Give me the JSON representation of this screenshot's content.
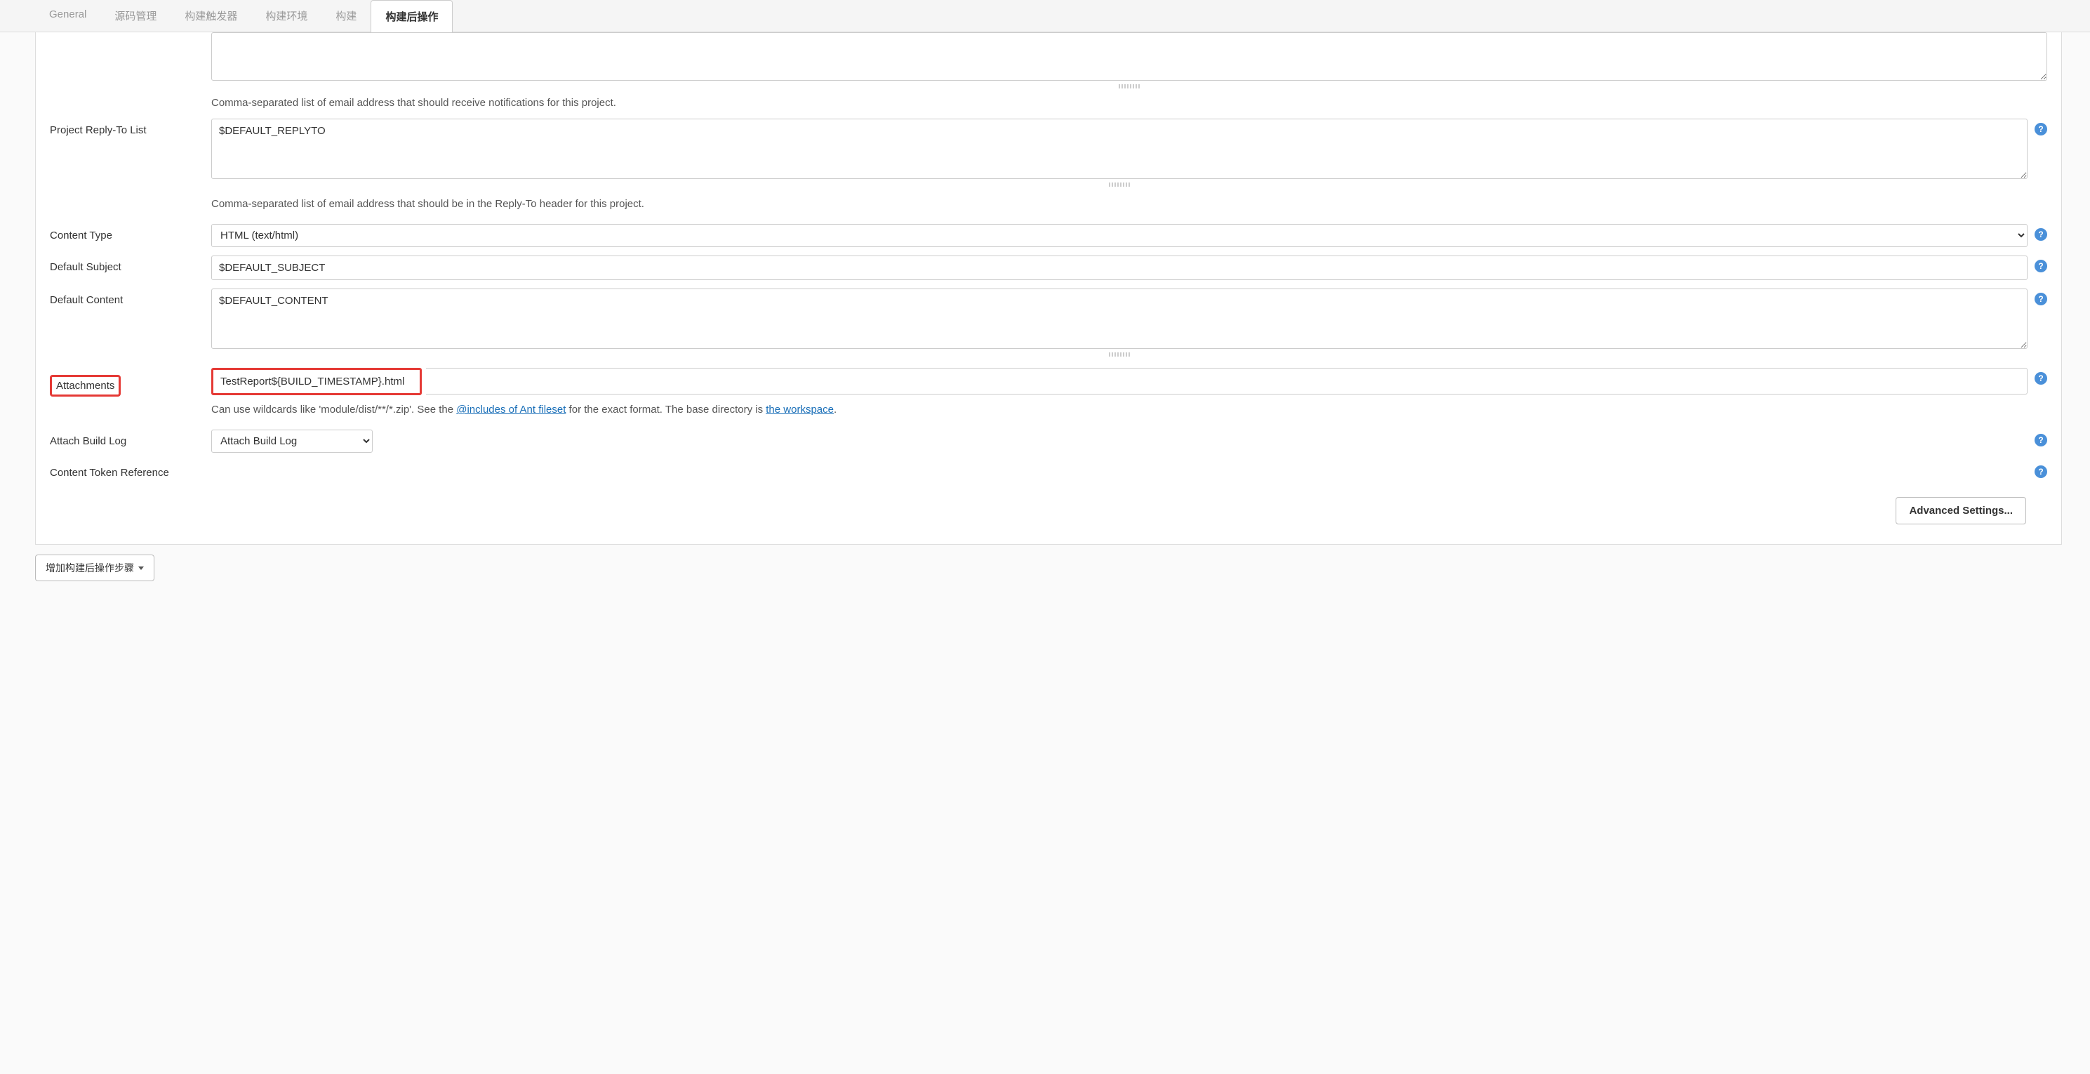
{
  "tabs": {
    "general": "General",
    "scm": "源码管理",
    "triggers": "构建触发器",
    "env": "构建环境",
    "build": "构建",
    "postbuild": "构建后操作"
  },
  "fields": {
    "recipientList": {
      "value": "",
      "help": "Comma-separated list of email address that should receive notifications for this project."
    },
    "replyTo": {
      "label": "Project Reply-To List",
      "value": "$DEFAULT_REPLYTO",
      "help": "Comma-separated list of email address that should be in the Reply-To header for this project."
    },
    "contentType": {
      "label": "Content Type",
      "value": "HTML (text/html)"
    },
    "defaultSubject": {
      "label": "Default Subject",
      "value": "$DEFAULT_SUBJECT"
    },
    "defaultContent": {
      "label": "Default Content",
      "value": "$DEFAULT_CONTENT"
    },
    "attachments": {
      "label": "Attachments",
      "value": "TestReport${BUILD_TIMESTAMP}.html",
      "help_prefix": "Can use wildcards like 'module/dist/**/*.zip'. See the ",
      "help_link1": "@includes of Ant fileset",
      "help_mid": " for the exact format. The base directory is ",
      "help_link2": "the workspace",
      "help_suffix": "."
    },
    "attachBuildLog": {
      "label": "Attach Build Log",
      "value": "Attach Build Log"
    },
    "contentTokenRef": {
      "label": "Content Token Reference"
    }
  },
  "buttons": {
    "advanced": "Advanced Settings...",
    "addPostBuildStep": "增加构建后操作步骤"
  },
  "helpIcon": "?"
}
